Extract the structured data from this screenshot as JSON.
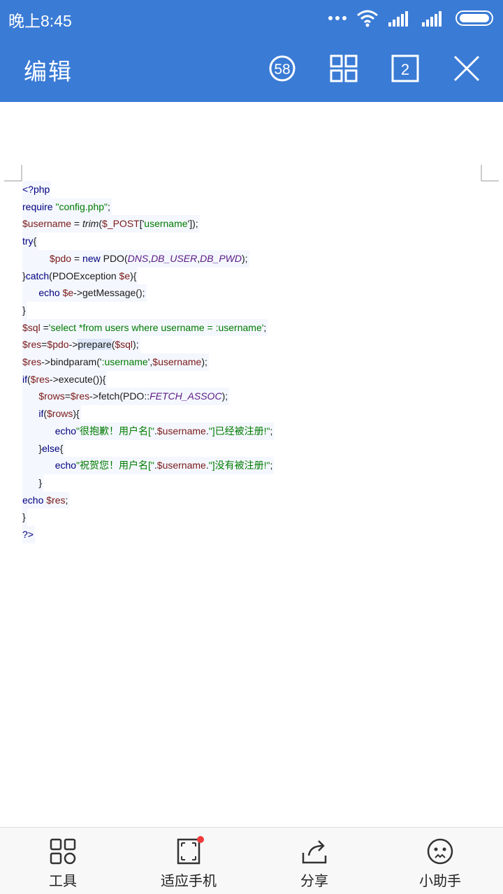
{
  "status_bar": {
    "time": "晚上8:45"
  },
  "app_bar": {
    "title": "编辑",
    "badge_count": "58",
    "page_count": "2"
  },
  "code_lines": [
    [
      [
        "k",
        "<?php"
      ]
    ],
    [
      [
        "k",
        "require "
      ],
      [
        "s",
        "\"config.php\""
      ],
      [
        "p",
        ";"
      ]
    ],
    [
      [
        "v",
        "$username"
      ],
      [
        "p",
        " = "
      ],
      [
        "fi",
        "trim"
      ],
      [
        "p",
        "("
      ],
      [
        "v",
        "$_POST"
      ],
      [
        "p",
        "['"
      ],
      [
        "s",
        "username"
      ],
      [
        "p",
        "']);"
      ]
    ],
    [
      [
        "k",
        "try"
      ],
      [
        "p",
        "{"
      ]
    ],
    [
      [
        "p",
        "          "
      ],
      [
        "v",
        "$pdo"
      ],
      [
        "p",
        " = "
      ],
      [
        "k",
        "new "
      ],
      [
        "p",
        "PDO("
      ],
      [
        "i",
        "DNS"
      ],
      [
        "p",
        ","
      ],
      [
        "i",
        "DB_USER"
      ],
      [
        "p",
        ","
      ],
      [
        "i",
        "DB_PWD"
      ],
      [
        "p",
        ");"
      ]
    ],
    [
      [
        "p",
        "}"
      ],
      [
        "k",
        "catch"
      ],
      [
        "p",
        "(PDOException "
      ],
      [
        "v",
        "$e"
      ],
      [
        "p",
        "){"
      ]
    ],
    [
      [
        "p",
        "      "
      ],
      [
        "k",
        "echo "
      ],
      [
        "v",
        "$e"
      ],
      [
        "p",
        "->getMessage();"
      ]
    ],
    [
      [
        "p",
        "}"
      ]
    ],
    [
      [
        "v",
        "$sql"
      ],
      [
        "p",
        " ="
      ],
      [
        "s",
        "'select *from users where username = :username'"
      ],
      [
        "p",
        ";"
      ]
    ],
    [
      [
        "v",
        "$res"
      ],
      [
        "p",
        "="
      ],
      [
        "v",
        "$pdo"
      ],
      [
        "p",
        "->"
      ],
      [
        "h",
        "prepare"
      ],
      [
        "p",
        "("
      ],
      [
        "v",
        "$sql"
      ],
      [
        "p",
        ");"
      ]
    ],
    [
      [
        "v",
        "$res"
      ],
      [
        "p",
        "->bindparam('"
      ],
      [
        "s",
        ":username"
      ],
      [
        "p",
        "',"
      ],
      [
        "v",
        "$username"
      ],
      [
        "p",
        ");"
      ]
    ],
    [
      [
        "k",
        "if"
      ],
      [
        "p",
        "("
      ],
      [
        "v",
        "$res"
      ],
      [
        "p",
        "->execute()){"
      ]
    ],
    [
      [
        "p",
        "      "
      ],
      [
        "v",
        "$rows"
      ],
      [
        "p",
        "="
      ],
      [
        "v",
        "$res"
      ],
      [
        "p",
        "->fetch(PDO::"
      ],
      [
        "i",
        "FETCH_ASSOC"
      ],
      [
        "p",
        ");"
      ]
    ],
    [
      [
        "p",
        "      "
      ],
      [
        "k",
        "if"
      ],
      [
        "p",
        "("
      ],
      [
        "v",
        "$rows"
      ],
      [
        "p",
        "){"
      ]
    ],
    [
      [
        "p",
        "            "
      ],
      [
        "k",
        "echo"
      ],
      [
        "s",
        "\"很抱歉！用户名[\""
      ],
      [
        "p",
        "."
      ],
      [
        "v",
        "$username"
      ],
      [
        "p",
        "."
      ],
      [
        "s",
        "\"]已经被注册!\""
      ],
      [
        "p",
        ";"
      ]
    ],
    [
      [
        "p",
        "      }"
      ],
      [
        "k",
        "else"
      ],
      [
        "p",
        "{"
      ]
    ],
    [
      [
        "p",
        "            "
      ],
      [
        "k",
        "echo"
      ],
      [
        "s",
        "\"祝贺您！用户名[\""
      ],
      [
        "p",
        "."
      ],
      [
        "v",
        "$username"
      ],
      [
        "p",
        "."
      ],
      [
        "s",
        "\"]没有被注册!\""
      ],
      [
        "p",
        ";"
      ]
    ],
    [
      [
        "p",
        "      }"
      ]
    ],
    [
      [
        "k",
        "echo "
      ],
      [
        "v",
        "$res"
      ],
      [
        "p",
        ";"
      ]
    ],
    [
      [
        "p",
        "}"
      ]
    ],
    [
      [
        "k",
        "?>"
      ]
    ]
  ],
  "bottom_bar": {
    "tools": "工具",
    "fit_phone": "适应手机",
    "share": "分享",
    "assistant": "小助手"
  }
}
